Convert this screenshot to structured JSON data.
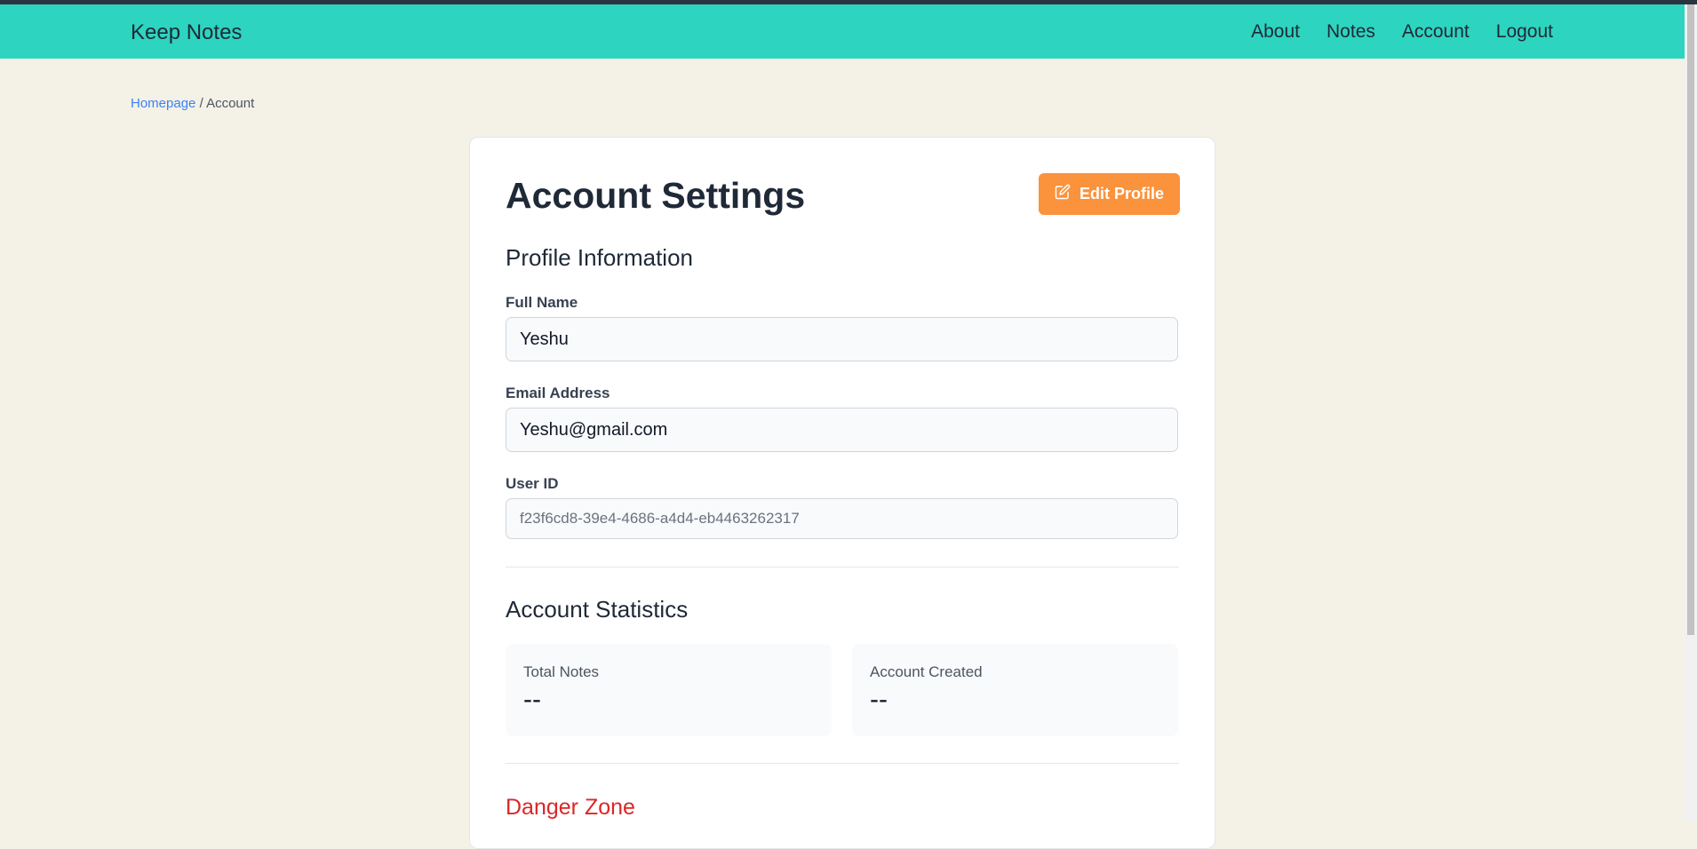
{
  "app": {
    "brand": "Keep Notes",
    "nav": [
      "About",
      "Notes",
      "Account",
      "Logout"
    ]
  },
  "breadcrumb": {
    "home": "Homepage",
    "separator": "/",
    "current": "Account"
  },
  "page": {
    "title": "Account Settings",
    "edit_button": "Edit Profile"
  },
  "profile": {
    "heading": "Profile Information",
    "full_name_label": "Full Name",
    "full_name_value": "Yeshu",
    "email_label": "Email Address",
    "email_value": "Yeshu@gmail.com",
    "user_id_label": "User ID",
    "user_id_value": "f23f6cd8-39e4-4686-a4d4-eb4463262317"
  },
  "statistics": {
    "heading": "Account Statistics",
    "total_notes_label": "Total Notes",
    "total_notes_value": "--",
    "created_label": "Account Created",
    "created_value": "--"
  },
  "danger": {
    "heading": "Danger Zone"
  },
  "colors": {
    "navbar": "#2dd4bf",
    "background": "#f4f1e6",
    "accent_button": "#fb923c",
    "danger": "#dc2626",
    "link": "#3b82f6"
  }
}
